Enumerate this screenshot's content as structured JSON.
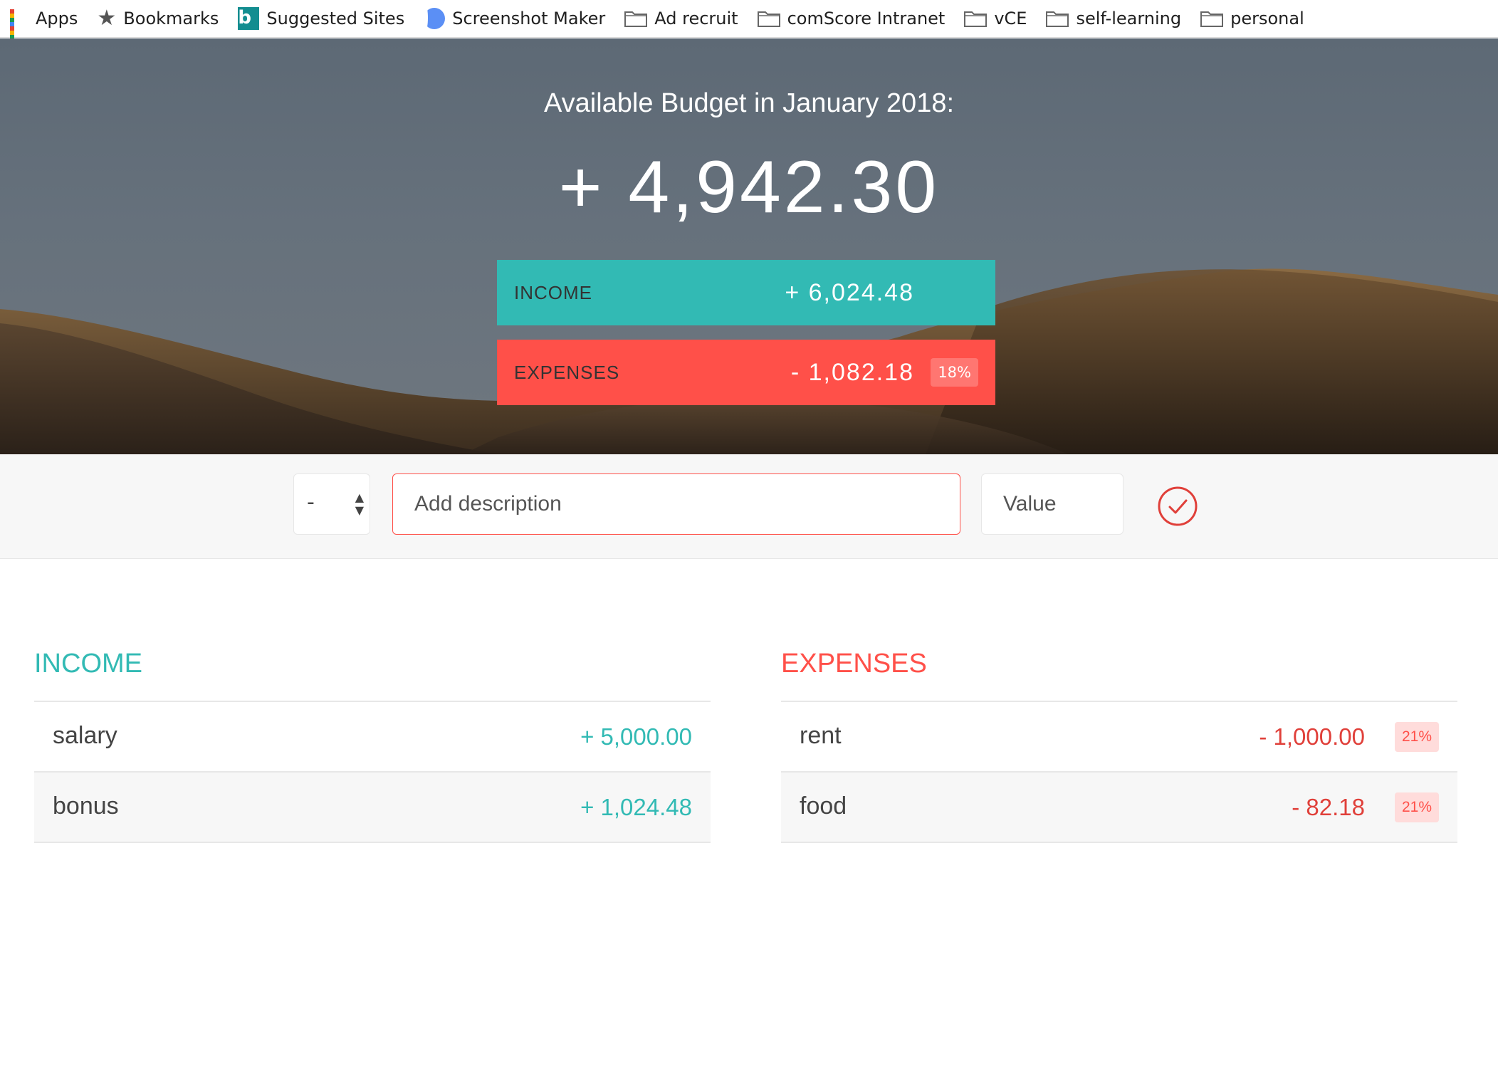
{
  "bookmarks": [
    {
      "label": "Apps",
      "icon": "apps-grid-icon"
    },
    {
      "label": "Bookmarks",
      "icon": "star-icon"
    },
    {
      "label": "Suggested Sites",
      "icon": "bing-icon"
    },
    {
      "label": "Screenshot Maker",
      "icon": "screenshot-maker-icon"
    },
    {
      "label": "Ad recruit",
      "icon": "folder-icon"
    },
    {
      "label": "comScore Intranet",
      "icon": "folder-icon"
    },
    {
      "label": "vCE",
      "icon": "folder-icon"
    },
    {
      "label": "self-learning",
      "icon": "folder-icon"
    },
    {
      "label": "personal",
      "icon": "folder-icon"
    }
  ],
  "budget": {
    "title": "Available Budget in January 2018:",
    "value": "+ 4,942.30"
  },
  "summary": {
    "income_label": "INCOME",
    "income_value": "+ 6,024.48",
    "expenses_label": "EXPENSES",
    "expenses_value": "- 1,082.18",
    "expenses_percentage": "18%"
  },
  "add": {
    "type_value": "-",
    "description_placeholder": "Add description",
    "value_placeholder": "Value"
  },
  "income": {
    "title": "INCOME",
    "items": [
      {
        "description": "salary",
        "value": "+ 5,000.00"
      },
      {
        "description": "bonus",
        "value": "+ 1,024.48"
      }
    ]
  },
  "expenses": {
    "title": "EXPENSES",
    "items": [
      {
        "description": "rent",
        "value": "- 1,000.00",
        "percentage": "21%"
      },
      {
        "description": "food",
        "value": "- 82.18",
        "percentage": "21%"
      }
    ]
  },
  "colors": {
    "income": "#32bab4",
    "expenses": "#ff5049",
    "hero_sky": "#5d6975"
  }
}
